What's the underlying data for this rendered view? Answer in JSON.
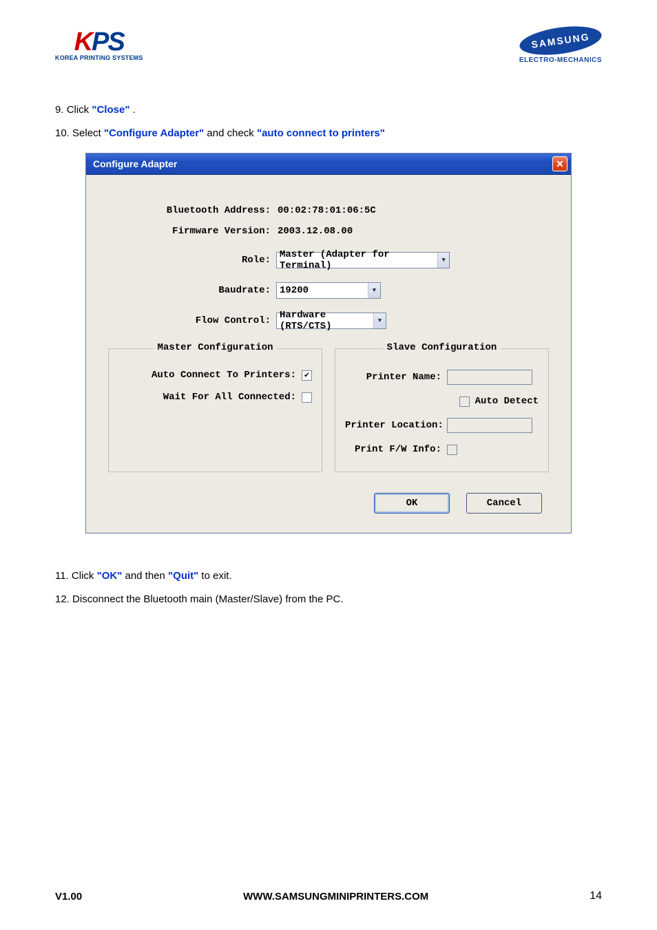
{
  "header": {
    "kps": {
      "sub": "KOREA PRINTING SYSTEMS"
    },
    "samsung": {
      "name": "SAMSUNG",
      "sub": "ELECTRO-MECHANICS"
    }
  },
  "instructions": {
    "i9": {
      "num": "9. ",
      "pre": "Click ",
      "hl1": "\"Close\"",
      "post": " ."
    },
    "i10": {
      "num": "10. ",
      "pre": "Select ",
      "hl1": "\"Configure Adapter\"",
      "mid": " and check ",
      "hl2": "\"auto connect to printers\""
    },
    "i11": {
      "num": "11. ",
      "pre": "Click ",
      "hl1": "\"OK\"",
      "mid": " and then ",
      "hl2": "\"Quit\"",
      "post": " to exit."
    },
    "i12": {
      "num": "12. ",
      "text": "Disconnect the Bluetooth main (Master/Slave) from the PC."
    }
  },
  "dialog": {
    "title": "Configure Adapter",
    "bt_addr_label": "Bluetooth Address:",
    "bt_addr_value": "00:02:78:01:06:5C",
    "fw_label": "Firmware Version:",
    "fw_value": "2003.12.08.00",
    "role_label": "Role:",
    "role_value": "Master (Adapter for Terminal)",
    "baud_label": "Baudrate:",
    "baud_value": "19200",
    "flow_label": "Flow Control:",
    "flow_value": "Hardware (RTS/CTS)",
    "master": {
      "legend": "Master Configuration",
      "auto_connect_label": "Auto Connect To Printers:",
      "wait_all_label": "Wait For All Connected:"
    },
    "slave": {
      "legend": "Slave Configuration",
      "printer_name_label": "Printer Name:",
      "auto_detect_label": "Auto Detect",
      "printer_loc_label": "Printer Location:",
      "print_fw_label": "Print F/W Info:"
    },
    "ok_label": "OK",
    "cancel_label": "Cancel"
  },
  "footer": {
    "version": "V1.00",
    "site": "WWW.SAMSUNGMINIPRINTERS.COM",
    "pagenum": "14"
  }
}
